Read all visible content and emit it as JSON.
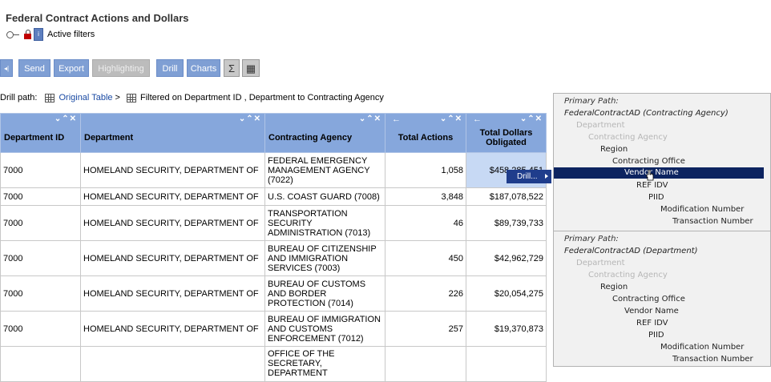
{
  "page": {
    "title": "Federal Contract Actions and Dollars",
    "filters_label": "Active filters"
  },
  "toolbar": {
    "collapse_glyph": "◂|",
    "send": "Send",
    "export": "Export",
    "highlighting": "Highlighting",
    "drill": "Drill",
    "charts": "Charts",
    "sigma": "Σ",
    "table_glyph": "▦"
  },
  "drill": {
    "label": "Drill path:",
    "original_table": "Original Table",
    "sep": ">",
    "filtered": "Filtered on Department ID , Department to Contracting Agency"
  },
  "table": {
    "columns": [
      {
        "label": "Department ID",
        "controls": "⌄⌃✕"
      },
      {
        "label": "Department",
        "controls": "⌄⌃✕"
      },
      {
        "label": "Contracting Agency",
        "controls": "⌄⌃✕"
      },
      {
        "label": "Total Actions",
        "controls": "⌄⌃✕",
        "left": "←"
      },
      {
        "label": "Total Dollars Obligated",
        "controls": "⌄⌃✕",
        "left": "←"
      }
    ],
    "rows": [
      {
        "id": "7000",
        "dept": "HOMELAND SECURITY, DEPARTMENT OF",
        "agency": "FEDERAL EMERGENCY MANAGEMENT AGENCY (7022)",
        "actions": "1,058",
        "dollars": "$458,285,451"
      },
      {
        "id": "7000",
        "dept": "HOMELAND SECURITY, DEPARTMENT OF",
        "agency": "U.S. COAST GUARD (7008)",
        "actions": "3,848",
        "dollars": "$187,078,522"
      },
      {
        "id": "7000",
        "dept": "HOMELAND SECURITY, DEPARTMENT OF",
        "agency": "TRANSPORTATION SECURITY ADMINISTRATION (7013)",
        "actions": "46",
        "dollars": "$89,739,733"
      },
      {
        "id": "7000",
        "dept": "HOMELAND SECURITY, DEPARTMENT OF",
        "agency": "BUREAU OF CITIZENSHIP AND IMMIGRATION SERVICES (7003)",
        "actions": "450",
        "dollars": "$42,962,729"
      },
      {
        "id": "7000",
        "dept": "HOMELAND SECURITY, DEPARTMENT OF",
        "agency": "BUREAU OF CUSTOMS AND BORDER PROTECTION (7014)",
        "actions": "226",
        "dollars": "$20,054,275"
      },
      {
        "id": "7000",
        "dept": "HOMELAND SECURITY, DEPARTMENT OF",
        "agency": "BUREAU OF IMMIGRATION AND CUSTOMS ENFORCEMENT (7012)",
        "actions": "257",
        "dollars": "$19,370,873"
      },
      {
        "id": "",
        "dept": "",
        "agency": "OFFICE OF THE SECRETARY, DEPARTMENT",
        "actions": "",
        "dollars": ""
      }
    ]
  },
  "context_menu": {
    "drill": "Drill..."
  },
  "drill_panel": {
    "sections": [
      {
        "title": "Primary Path:",
        "path": "FederalContractAD (Contracting Agency)",
        "levels": [
          "Department",
          "Contracting Agency",
          "Region",
          "Contracting Office",
          "Vendor Name",
          "REF IDV",
          "PIID",
          "Modification Number",
          "Transaction Number"
        ],
        "dim": [
          true,
          true,
          false,
          false,
          false,
          false,
          false,
          false,
          false
        ],
        "highlight_index": 4
      },
      {
        "title": "Primary Path:",
        "path": "FederalContractAD (Department)",
        "levels": [
          "Department",
          "Contracting Agency",
          "Region",
          "Contracting Office",
          "Vendor Name",
          "REF IDV",
          "PIID",
          "Modification Number",
          "Transaction Number"
        ],
        "dim": [
          true,
          true,
          false,
          false,
          false,
          false,
          false,
          false,
          false
        ],
        "highlight_index": -1
      }
    ]
  },
  "colors": {
    "header_bg": "#86a7dc",
    "button_bg": "#7f9fd4",
    "highlight": "#0d2460",
    "selected_cell": "#c7d9f4"
  }
}
